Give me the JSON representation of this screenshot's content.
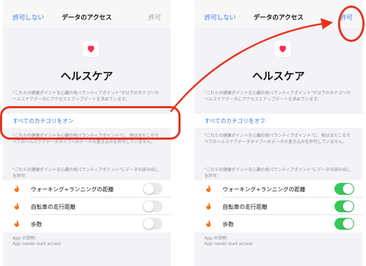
{
  "screens": [
    {
      "nav": {
        "left": "許可しない",
        "title": "データのアクセス",
        "right": "許可"
      },
      "app_name": "ヘルスケア",
      "desc1": "\"これらの健康ポイントを心臓の他バランティアポイント\"が以下のカテゴリのヘルスケアデータにアクセスとアップデートを求めています。",
      "toggle_all": "すべてのカテゴリをオン",
      "desc2": "\"これらの健康ポイントを心臓の他パランティアポイント\"に、他はまだこのすべてのヘルスケアデータタイプへのデータの書き込みを許可していません。",
      "desc3": "\"これらの健康ポイントを心臓の他パランティアポイント\"にデータの読み出しを許可：",
      "items": [
        {
          "label": "ウォーキング+ランニングの距離",
          "on": false
        },
        {
          "label": "自転車の走行距離",
          "on": false
        },
        {
          "label": "歩数",
          "on": false
        }
      ],
      "footer": "App の説明:\nApp needs read access"
    },
    {
      "nav": {
        "left": "許可しない",
        "title": "データのアクセス",
        "right": "許可"
      },
      "app_name": "ヘルスケア",
      "desc1": "\"これらの健康ポイントを心臓の他バランティアポイント\"が以下のカテゴリのヘルスケアデータにアクセスとアップデートを求めています。",
      "toggle_all": "すべてのカテゴリをオフ",
      "desc2": "\"これらの健康ポイントを心臓の他パランティアポイント\"に、他はまだこのすべてのヘルスケアデータタイプへのデータの書き込みを許可していません。",
      "desc3": "\"これらの健康ポイントを心臓の他パランティアポイント\"にデータの読み出しを許可：",
      "items": [
        {
          "label": "ウォーキング+ランニングの距離",
          "on": true
        },
        {
          "label": "自転車の走行距離",
          "on": true
        },
        {
          "label": "歩数",
          "on": true
        }
      ],
      "footer": "App の説明:\nApp needs read access"
    }
  ],
  "icons": {
    "app": "heart-icon",
    "item": "flame-icon"
  },
  "colors": {
    "accent": "#3478f6",
    "switch_on": "#34c759",
    "heart": "#ff2d55",
    "flame": "#ff6a00",
    "annotation": "#e8321c"
  }
}
